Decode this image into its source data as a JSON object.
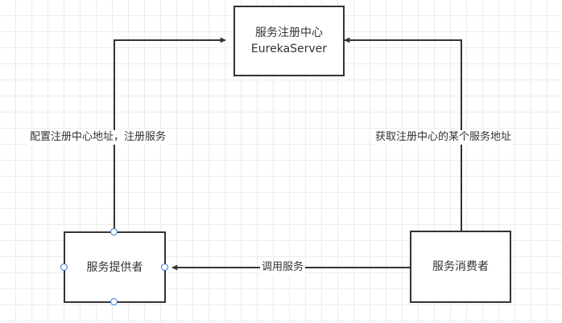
{
  "nodes": {
    "registry": {
      "title": "服务注册中心",
      "subtitle": "EurekaServer"
    },
    "provider": {
      "label": "服务提供者"
    },
    "consumer": {
      "label": "服务消费者"
    }
  },
  "edges": {
    "register": {
      "label": "配置注册中心地址，注册服务"
    },
    "discover": {
      "label": "获取注册中心的某个服务地址"
    },
    "invoke": {
      "label": "调用服务"
    }
  },
  "colors": {
    "stroke": "#333333",
    "text": "#333333",
    "grid": "#ececec",
    "handle": "#2b7bd6"
  }
}
